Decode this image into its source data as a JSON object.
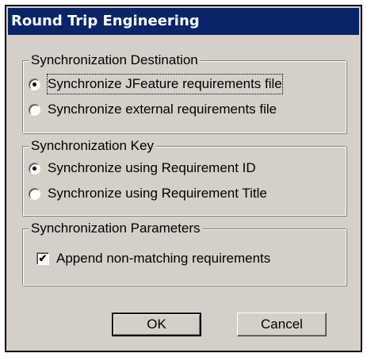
{
  "dialog": {
    "title": "Round Trip Engineering"
  },
  "destination_group": {
    "label": "Synchronization Destination",
    "options": [
      {
        "label": "Synchronize JFeature requirements file",
        "selected": true
      },
      {
        "label": "Synchronize external requirements file",
        "selected": false
      }
    ]
  },
  "key_group": {
    "label": "Synchronization Key",
    "options": [
      {
        "label": "Synchronize using Requirement ID",
        "selected": true
      },
      {
        "label": "Synchronize using Requirement Title",
        "selected": false
      }
    ]
  },
  "parameters_group": {
    "label": "Synchronization Parameters",
    "append_checkbox": {
      "label": "Append non-matching requirements",
      "checked": true
    }
  },
  "buttons": {
    "ok_label": "OK",
    "cancel_label": "Cancel"
  },
  "colors": {
    "titlebar": "#0a246a",
    "dialog_face": "#d4d0c8"
  },
  "icons": {
    "radio_selected": "radio-dot-icon",
    "checkmark": "checkmark-icon"
  }
}
